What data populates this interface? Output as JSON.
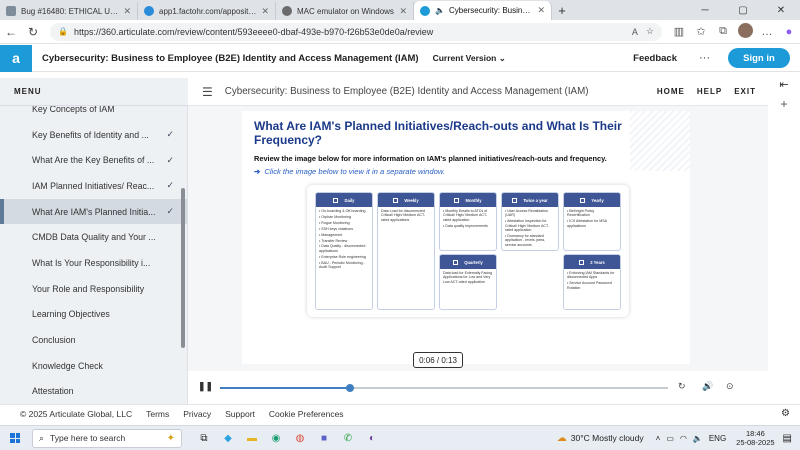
{
  "browser": {
    "tabs": [
      {
        "label": "Bug #16480: ETHICAL UI/UX DESI",
        "color": "#7f8c99",
        "active": false
      },
      {
        "label": "app1.factohr.com/apposite/Welco",
        "color": "#2a8bd8",
        "active": false
      },
      {
        "label": "MAC emulator on Windows",
        "color": "#6b6b6b",
        "active": false
      },
      {
        "label": "Cybersecurity: Business to Em",
        "color": "#1d9bd8",
        "active": true
      }
    ],
    "new_tab": "+",
    "url": "https://360.articulate.com/review/content/593eeee0-dbaf-493e-b970-f26b53e0de0a/review"
  },
  "app": {
    "logo": "a",
    "course_title": "Cybersecurity: Business to Employee (B2E) Identity and Access Management (IAM)",
    "current_version": "Current Version",
    "feedback": "Feedback",
    "more": "···",
    "signin": "Sign in"
  },
  "player": {
    "menu_label": "MENU",
    "menu_items": [
      {
        "label": "Key Concepts of IAM",
        "checked": false,
        "active": false
      },
      {
        "label": "Key Benefits of Identity and ...",
        "checked": true,
        "active": false
      },
      {
        "label": "What Are the Key Benefits of ...",
        "checked": true,
        "active": false
      },
      {
        "label": "IAM Planned Initiatives/ Reac...",
        "checked": true,
        "active": false
      },
      {
        "label": "What Are IAM's Planned Initia...",
        "checked": true,
        "active": true
      },
      {
        "label": "CMDB Data Quality and Your ...",
        "checked": false,
        "active": false
      },
      {
        "label": "What Is Your Responsibility i...",
        "checked": false,
        "active": false
      },
      {
        "label": "Your Role and Responsibility",
        "checked": false,
        "active": false
      },
      {
        "label": "Learning Objectives",
        "checked": false,
        "active": false
      },
      {
        "label": "Conclusion",
        "checked": false,
        "active": false
      },
      {
        "label": "Knowledge Check",
        "checked": false,
        "active": false
      },
      {
        "label": "Attestation",
        "checked": false,
        "active": false
      }
    ],
    "check_glyph": "✓",
    "header_title": "Cybersecurity: Business to Employee (B2E) Identity and Access Management (IAM)",
    "nav": {
      "home": "HOME",
      "help": "HELP",
      "exit": "EXIT"
    },
    "time": "0:06 / 0:13",
    "progress": 0.29
  },
  "slide": {
    "title": "What Are IAM's Planned Initiatives/Reach-outs and What Is Their Frequency?",
    "instruction": "Review the image below for more information on IAM's planned initiatives/reach-outs and frequency.",
    "click_arrow": "➔",
    "click_text": "Click the image below to view it in a separate window.",
    "columns": [
      {
        "title": "Daily",
        "items": [
          "On-boarding & Off-boarding",
          "Orphan Monitoring",
          "Rogue Monitoring",
          "SSH keys violations",
          "Management",
          "Transfer Review",
          "Data Quality - disconnected applications",
          "Enterprise Role engineering",
          "BAU - Periodic Monitoring - Audit Support"
        ],
        "bullets": true
      },
      {
        "title": "Weekly",
        "items": [
          "Data Load for disconnected Critical/ High/ Medium ACT-rated applications"
        ],
        "bullets": false
      },
      {
        "title": "Monthly",
        "items": [
          "Monthly Emails to ATCs of Critical/ High/ Medium ACT-rated application",
          "Data quality improvements"
        ],
        "bullets": true
      },
      {
        "title": "Twice a year",
        "items": [
          "User Access Revalidation (UAR)",
          "Attestation Inspection for Critical/ High/ Medium ACT-rated application",
          "Dormancy for standard application - levels (area, service accounts"
        ],
        "bullets": true
      },
      {
        "title": "Yearly",
        "items": [
          "Birthright Policy Recertification",
          "ICS Attestation for MSA applications"
        ],
        "bullets": true
      }
    ],
    "quarterly": {
      "title": "Quarterly",
      "items": [
        "Data load for Externally Facing Applications for Low and Very Low ACT-rated application"
      ]
    },
    "two_years": {
      "title": "2 Years",
      "items": [
        "Enforcing IAM Standards for disconnected Apps",
        "Service Account Password Rotation"
      ]
    }
  },
  "footer": {
    "copyright": "© 2025 Articulate Global, LLC",
    "terms": "Terms",
    "privacy": "Privacy",
    "support": "Support",
    "cookie": "Cookie Preferences"
  },
  "taskbar": {
    "search_placeholder": "Type here to search",
    "weather": "30°C  Mostly cloudy",
    "lang": "ENG",
    "time": "18:46",
    "date": "25-08-2025"
  }
}
